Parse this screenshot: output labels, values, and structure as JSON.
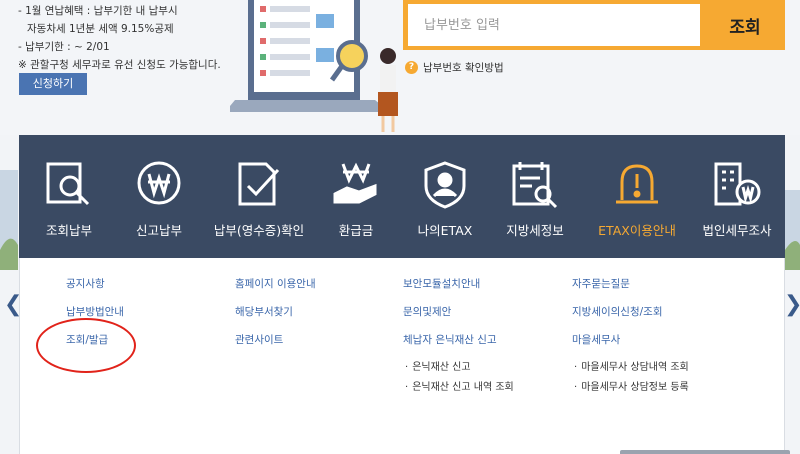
{
  "info": {
    "line1": "- 1월 연납혜택 : 납부기한 내 납부시",
    "line2": "자동차세 1년분 세액 9.15%공제",
    "line3": "- 납부기한 : ~ 2/01",
    "line4": "※ 관할구청 세무과로 유선 신청도 가능합니다."
  },
  "apply_label": "신청하기",
  "search": {
    "placeholder": "납부번호 입력",
    "button_label": "조회",
    "hint": "납부번호 확인방법"
  },
  "nav": [
    {
      "label": "조회납부",
      "icon": "magnifier-document-icon"
    },
    {
      "label": "신고납부",
      "icon": "won-coin-icon"
    },
    {
      "label": "납부(영수증)확인",
      "icon": "receipt-check-icon"
    },
    {
      "label": "환급금",
      "icon": "refund-hand-icon"
    },
    {
      "label": "나의ETAX",
      "icon": "user-shield-icon"
    },
    {
      "label": "지방세정보",
      "icon": "calendar-search-icon"
    },
    {
      "label": "ETAX이용안내",
      "icon": "alert-bell-icon",
      "active": true
    },
    {
      "label": "법인세무조사",
      "icon": "building-won-icon"
    }
  ],
  "menu": {
    "col1": [
      "공지사항",
      "납부방법안내",
      "조회/발급"
    ],
    "col2": [
      "홈페이지 이용안내",
      "해당부서찾기",
      "관련사이트"
    ],
    "col3": [
      "보안모듈설치안내",
      "문의및제안",
      "체납자 은닉재산 신고"
    ],
    "col3_sub": [
      "은닉재산 신고",
      "은닉재산 신고 내역 조회"
    ],
    "col4": [
      "자주묻는질문",
      "지방세이의신청/조회",
      "마을세무사"
    ],
    "col4_sub": [
      "마을세무사 상담내역 조회",
      "마을세무사 상담정보 등록"
    ]
  },
  "colors": {
    "nav_bg": "#3a4a63",
    "accent": "#f6a932",
    "link": "#3a66aa",
    "highlight": "#e1231a"
  }
}
